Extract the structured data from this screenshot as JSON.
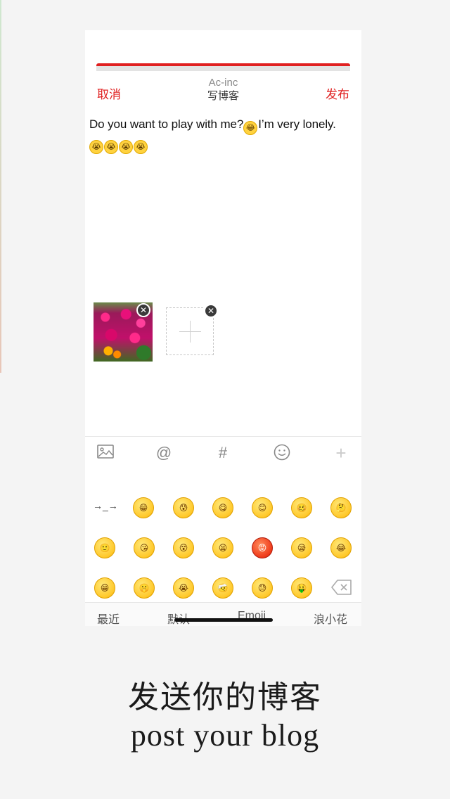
{
  "nav": {
    "cancel_label": "取消",
    "publish_label": "发布",
    "username": "Ac-inc",
    "title": "写博客",
    "accent_color": "#e02020"
  },
  "post": {
    "text_before": "Do you want to play with me?",
    "inline_emoji": "laugh-cry",
    "text_after": "I’m very lonely.",
    "trailing_emojis": [
      "crying-face",
      "crying-face",
      "crying-face",
      "crying-face"
    ]
  },
  "media": {
    "photo": "pink-flowers-photo",
    "remove_icon": "close-icon",
    "add_icon": "plus-icon"
  },
  "toolbar": {
    "icons": [
      "image-icon",
      "at-icon",
      "hashtag-icon",
      "smiley-icon",
      "plus-icon"
    ],
    "at_glyph": "@",
    "hash_glyph": "#",
    "plus_glyph": "+"
  },
  "emoji_panel": {
    "arrows_glyph": "→_→",
    "rows": [
      [
        "grin",
        "sweat-surprised",
        "tongue-out",
        "blush",
        "shy",
        "thinking"
      ],
      [
        "smile",
        "kiss-heart",
        "dizzy",
        "yelling",
        "angry",
        "sleepy",
        "laugh-cry"
      ],
      [
        "big-grin",
        "hush",
        "sob",
        "hurt",
        "sweat",
        "money-eyes"
      ]
    ],
    "delete_icon": "backspace-icon"
  },
  "tabs": [
    "最近",
    "默认",
    "Emoji",
    "浪小花"
  ],
  "caption": {
    "cn": "发送你的博客",
    "en": "post your blog"
  }
}
